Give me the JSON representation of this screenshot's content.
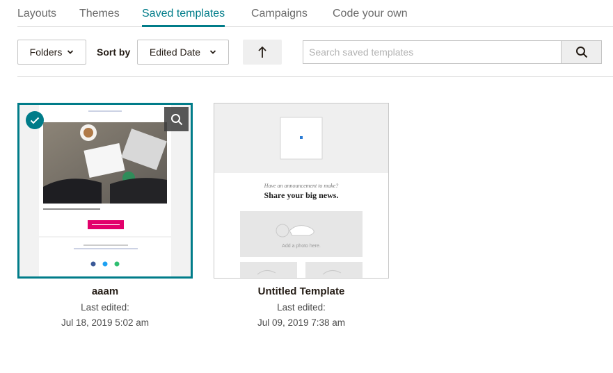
{
  "tabs": [
    {
      "label": "Layouts"
    },
    {
      "label": "Themes"
    },
    {
      "label": "Saved templates",
      "active": true
    },
    {
      "label": "Campaigns"
    },
    {
      "label": "Code your own"
    }
  ],
  "toolbar": {
    "folders_label": "Folders",
    "sort_by_label": "Sort by",
    "sort_value": "Edited Date",
    "search_placeholder": "Search saved templates"
  },
  "templates": [
    {
      "name": "aaam",
      "edited_label": "Last edited:",
      "edited_date": "Jul 18, 2019 5:02 am",
      "selected": true
    },
    {
      "name": "Untitled Template",
      "edited_label": "Last edited:",
      "edited_date": "Jul 09, 2019 7:38 am",
      "preview_kicker": "Have an announcement to make?",
      "preview_headline": "Share your big news.",
      "preview_photo_label": "Add a photo here."
    }
  ],
  "colors": {
    "accent": "#007c89",
    "cta": "#e2006b"
  }
}
